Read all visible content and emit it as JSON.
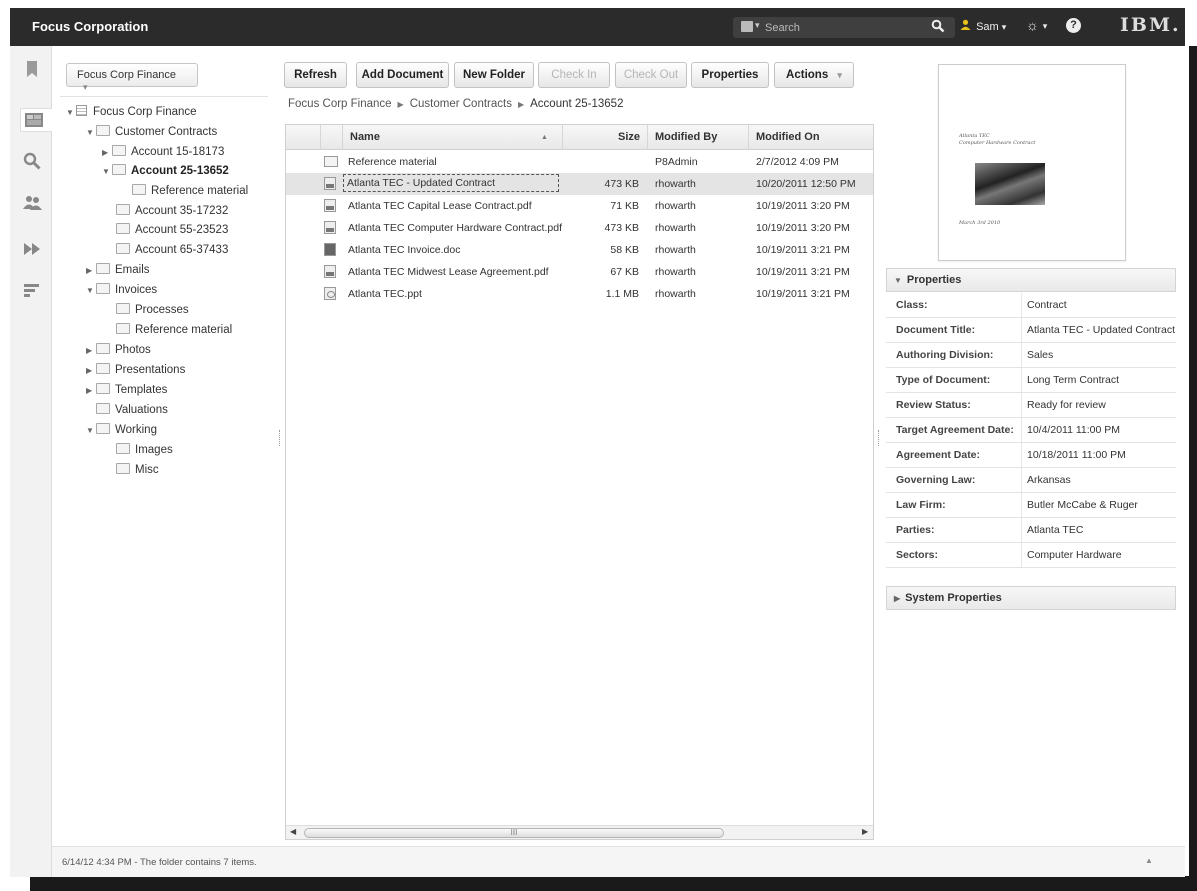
{
  "header": {
    "brand": "Focus Corporation",
    "search_placeholder": "Search",
    "user": "Sam",
    "logo": "IBM."
  },
  "tree": {
    "repository_select": "Focus Corp Finance",
    "nodes": [
      {
        "label": "Focus Corp Finance"
      },
      {
        "label": "Customer Contracts"
      },
      {
        "label": "Account 15-18173"
      },
      {
        "label": "Account 25-13652"
      },
      {
        "label": "Reference material"
      },
      {
        "label": "Account 35-17232"
      },
      {
        "label": "Account 55-23523"
      },
      {
        "label": "Account 65-37433"
      },
      {
        "label": "Emails"
      },
      {
        "label": "Invoices"
      },
      {
        "label": "Processes"
      },
      {
        "label": "Reference material"
      },
      {
        "label": "Photos"
      },
      {
        "label": "Presentations"
      },
      {
        "label": "Templates"
      },
      {
        "label": "Valuations"
      },
      {
        "label": "Working"
      },
      {
        "label": "Images"
      },
      {
        "label": "Misc"
      }
    ]
  },
  "toolbar": {
    "refresh": "Refresh",
    "add_document": "Add Document",
    "new_folder": "New Folder",
    "check_in": "Check In",
    "check_out": "Check Out",
    "properties": "Properties",
    "actions": "Actions"
  },
  "breadcrumb": [
    "Focus Corp Finance",
    "Customer Contracts",
    "Account 25-13652"
  ],
  "grid": {
    "columns": [
      "Name",
      "Size",
      "Modified By",
      "Modified On"
    ],
    "rows": [
      {
        "type": "folder",
        "name": "Reference material",
        "size": "",
        "modified_by": "P8Admin",
        "modified_on": "2/7/2012 4:09 PM"
      },
      {
        "type": "pdf",
        "name": "Atlanta TEC - Updated Contract",
        "size": "473 KB",
        "modified_by": "rhowarth",
        "modified_on": "10/20/2011 12:50 PM"
      },
      {
        "type": "pdf",
        "name": "Atlanta TEC Capital Lease Contract.pdf",
        "size": "71 KB",
        "modified_by": "rhowarth",
        "modified_on": "10/19/2011 3:20 PM"
      },
      {
        "type": "pdf",
        "name": "Atlanta TEC Computer Hardware Contract.pdf",
        "size": "473 KB",
        "modified_by": "rhowarth",
        "modified_on": "10/19/2011 3:20 PM"
      },
      {
        "type": "doc",
        "name": "Atlanta TEC Invoice.doc",
        "size": "58 KB",
        "modified_by": "rhowarth",
        "modified_on": "10/19/2011 3:21 PM"
      },
      {
        "type": "pdf",
        "name": "Atlanta TEC Midwest Lease Agreement.pdf",
        "size": "67 KB",
        "modified_by": "rhowarth",
        "modified_on": "10/19/2011 3:21 PM"
      },
      {
        "type": "ppt",
        "name": "Atlanta TEC.ppt",
        "size": "1.1 MB",
        "modified_by": "rhowarth",
        "modified_on": "10/19/2011 3:21 PM"
      }
    ],
    "scroll_label": "III"
  },
  "preview": {
    "title_line1": "Atlanta TEC",
    "title_line2": "Computer Hardware Contract",
    "date": "March 3rd 2010"
  },
  "properties": {
    "header": "Properties",
    "rows": [
      {
        "label": "Class:",
        "value": "Contract"
      },
      {
        "label": "Document Title:",
        "value": "Atlanta TEC - Updated Contract"
      },
      {
        "label": "Authoring Division:",
        "value": "Sales"
      },
      {
        "label": "Type of Document:",
        "value": "Long Term Contract"
      },
      {
        "label": "Review Status:",
        "value": "Ready for review"
      },
      {
        "label": "Target Agreement Date:",
        "value": "10/4/2011 11:00 PM"
      },
      {
        "label": "Agreement Date:",
        "value": "10/18/2011 11:00 PM"
      },
      {
        "label": "Governing Law:",
        "value": "Arkansas"
      },
      {
        "label": "Law Firm:",
        "value": "Butler McCabe & Ruger"
      },
      {
        "label": "Parties:",
        "value": "Atlanta TEC"
      },
      {
        "label": "Sectors:",
        "value": "Computer Hardware"
      }
    ]
  },
  "system_properties": {
    "header": "System Properties"
  },
  "status": {
    "text": "6/14/12 4:34 PM - The folder contains 7 items."
  }
}
